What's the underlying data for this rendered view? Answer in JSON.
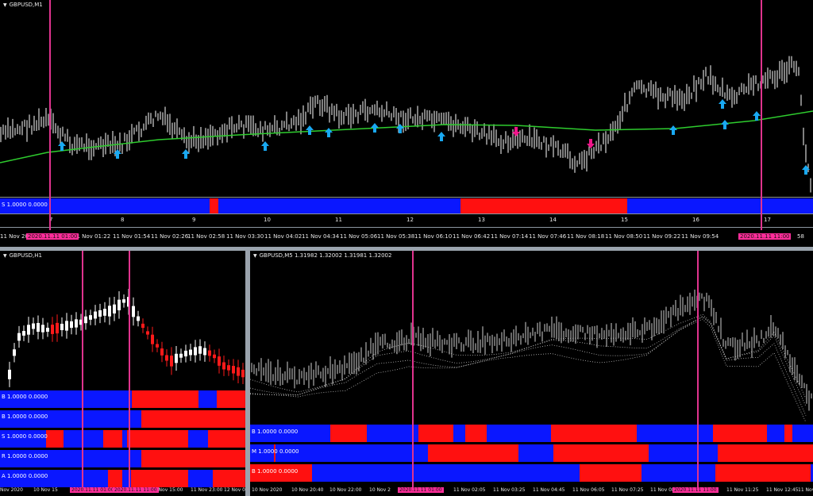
{
  "colors": {
    "background": "#000000",
    "candle_up": "#ffffff",
    "candle_down": "#ff1a1a",
    "strip_blue": "#0a17ff",
    "strip_red": "#ff1010",
    "ma_line": "#2ecc2e",
    "buy_arrow": "#19a9f2",
    "sell_arrow": "#f0158a",
    "vertical_line": "#e0338e",
    "tooltip": "#ff2d9a"
  },
  "top_chart": {
    "title": "GBPUSD,M1",
    "strip_label": "S 1.0000 0.0000",
    "day_numbers": [
      "7",
      "8",
      "9",
      "10",
      "11",
      "12",
      "13",
      "14",
      "15",
      "16",
      "17"
    ],
    "time_labels": [
      "11 Nov 20",
      "11 Nov 01:22",
      "11 Nov 01:54",
      "11 Nov 02:26",
      "11 Nov 02:58",
      "11 Nov 03:30",
      "11 Nov 04:02",
      "11 Nov 04:34",
      "11 Nov 05:06",
      "11 Nov 05:38",
      "11 Nov 06:10",
      "11 Nov 06:42",
      "11 Nov 07:14",
      "11 Nov 07:46",
      "11 Nov 08:18",
      "11 Nov 08:50",
      "11 Nov 09:22",
      "11 Nov 09:54",
      "58",
      "11 Nov"
    ],
    "cursor_tag_left": "2020.11.11 01:00",
    "cursor_tag_right": "2020.11.11 11:00"
  },
  "bottom_left_chart": {
    "title": "GBPUSD,H1",
    "strips": [
      {
        "label": "B 1.0000 0.0000"
      },
      {
        "label": "B 1.0000 0.0000"
      },
      {
        "label": "S 1.0000 0.0000"
      },
      {
        "label": "R 1.0000 0.0000"
      },
      {
        "label": "A 1.0000 0.0000"
      }
    ],
    "time_labels": [
      "Nov 2020",
      "10 Nov 15",
      "11 Nov 15:00",
      "11 Nov 23:00",
      "12 Nov 0"
    ],
    "cursor_tag_left": "2020.11.11 01:00",
    "cursor_tag_right": "2020.11.11 11:00"
  },
  "bottom_right_chart": {
    "title": "GBPUSD,M5  1.31982 1.32002 1.31981 1.32002",
    "strips": [
      {
        "label": "B 1.0000 0.0000"
      },
      {
        "label": "M 1.0000 0.0000"
      },
      {
        "label": "B 1.0000 0.0000"
      }
    ],
    "time_labels": [
      "10 Nov 2020",
      "10 Nov 20:40",
      "10 Nov 22:00",
      "10 Nov 2",
      "11 Nov 02:05",
      "11 Nov 03:25",
      "11 Nov 04:45",
      "11 Nov 06:05",
      "11 Nov 07:25",
      "11 Nov 08:45",
      "11 Nov 11:25",
      "11 Nov 12:45",
      "11 Nov 14:"
    ],
    "cursor_tag_left": "2020.11.11 01:00",
    "cursor_tag_right": "2020.11.11 11:00"
  }
}
